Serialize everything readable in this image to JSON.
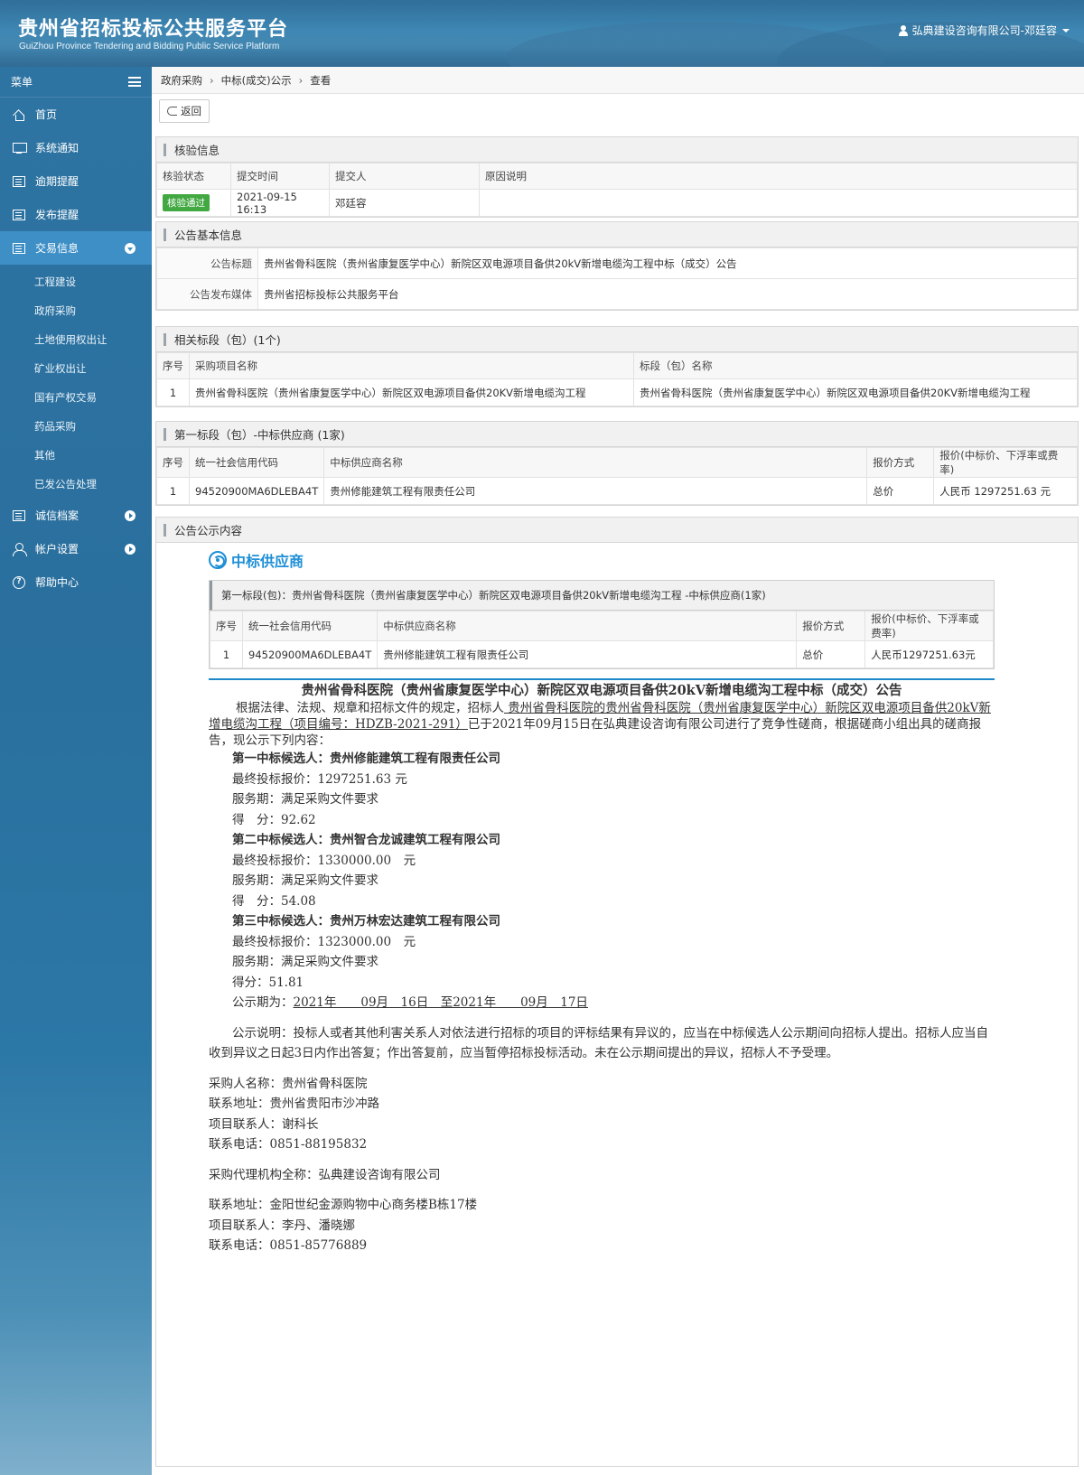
{
  "header": {
    "title": "贵州省招标投标公共服务平台",
    "subtitle": "GuiZhou Province Tendering and Bidding Public Service Platform",
    "user": "弘典建设咨询有限公司-邓廷容"
  },
  "sidebar": {
    "menu_label": "菜单",
    "items": [
      {
        "label": "首页",
        "icon": "home-icon"
      },
      {
        "label": "系统通知",
        "icon": "monitor-icon"
      },
      {
        "label": "逾期提醒",
        "icon": "list-icon"
      },
      {
        "label": "发布提醒",
        "icon": "list-icon"
      },
      {
        "label": "交易信息",
        "icon": "list-icon",
        "active": true
      }
    ],
    "sub_items": [
      "工程建设",
      "政府采购",
      "土地使用权出让",
      "矿业权出让",
      "国有产权交易",
      "药品采购",
      "其他",
      "已发公告处理"
    ],
    "bottom_items": [
      {
        "label": "诚信档案",
        "icon": "list-icon"
      },
      {
        "label": "帐户设置",
        "icon": "user-icon"
      },
      {
        "label": "帮助中心",
        "icon": "help-icon"
      }
    ],
    "colors": {
      "bg": "#2e74a3",
      "active": "#3d8fc6"
    }
  },
  "breadcrumb": [
    "政府采购",
    "中标(成交)公示",
    "查看"
  ],
  "toolbar": {
    "back_label": "返回"
  },
  "verify": {
    "title": "核验信息",
    "headers": [
      "核验状态",
      "提交时间",
      "提交人",
      "原因说明"
    ],
    "status": "核验通过",
    "time": "2021-09-15 16:13",
    "submitter": "邓廷容",
    "reason": ""
  },
  "basic": {
    "title": "公告基本信息",
    "notice_title_label": "公告标题",
    "notice_title": "贵州省骨科医院（贵州省康复医学中心）新院区双电源项目备供20kV新增电缆沟工程中标（成交）公告",
    "media_label": "公告发布媒体",
    "media": "贵州省招标投标公共服务平台"
  },
  "sections": {
    "title": "相关标段（包）(1个)",
    "headers": [
      "序号",
      "采购项目名称",
      "标段（包）名称"
    ],
    "rows": [
      [
        "1",
        "贵州省骨科医院（贵州省康复医学中心）新院区双电源项目备供20KV新增电缆沟工程",
        "贵州省骨科医院（贵州省康复医学中心）新院区双电源项目备供20KV新增电缆沟工程"
      ]
    ]
  },
  "winners": {
    "title": "第一标段（包）-中标供应商 (1家)",
    "headers": [
      "序号",
      "统一社会信用代码",
      "中标供应商名称",
      "报价方式",
      "报价(中标价、下浮率或费率)"
    ],
    "rows": [
      [
        "1",
        "94520900MA6DLEBA4T",
        "贵州修能建筑工程有限责任公司",
        "总价",
        "人民币 1297251.63 元"
      ]
    ]
  },
  "content": {
    "title": "公告公示内容",
    "win_title": "中标供应商",
    "inner_title": "第一标段(包)：贵州省骨科医院（贵州省康复医学中心）新院区双电源项目备供20kV新增电缆沟工程 -中标供应商(1家)",
    "inner_headers": [
      "序号",
      "统一社会信用代码",
      "中标供应商名称",
      "报价方式",
      "报价(中标价、下浮率或费率)"
    ],
    "inner_row": [
      "1",
      "94520900MA6DLEBA4T",
      "贵州修能建筑工程有限责任公司",
      "总价",
      "人民币1297251.63元"
    ],
    "doc_title": "贵州省骨科医院（贵州省康复医学中心）新院区双电源项目备供20kV新增电缆沟工程中标（成交）公告",
    "intro_a": "根据法律、法规、规章和招标文件的规定，招标人",
    "intro_b": " 贵州省骨科医院的贵州省骨科医院（贵州省康复医学中心）新院区双电源项目备供20kV新增电缆沟工程（项目编号：HDZB-2021-291）",
    "intro_c": "已于2021年09月15日在弘典建设咨询有限公司进行了竞争性磋商，根据磋商小组出具的磋商报告，现公示下列内容：",
    "c1_title": "第一中标候选人：贵州修能建筑工程有限责任公司",
    "c1_price": "最终投标报价：1297251.63 元",
    "c1_service": "服务期：满足采购文件要求",
    "c1_score": "得　分：92.62",
    "c2_title": "第二中标候选人：贵州智合龙诚建筑工程有限公司",
    "c2_price": "最终投标报价：1330000.00　元",
    "c2_service": "服务期：满足采购文件要求",
    "c2_score": "得　分：54.08",
    "c3_title": "第三中标候选人：贵州万林宏达建筑工程有限公司",
    "c3_price": "最终投标报价：1323000.00　元",
    "c3_service": "服务期：满足采购文件要求",
    "c3_score": "得分：51.81",
    "period_label": "公示期为：",
    "period_value": "2021年　　09月　16日　至2021年　　09月　17日",
    "remark": "公示说明：投标人或者其他利害关系人对依法进行招标的项目的评标结果有异议的，应当在中标候选人公示期间向招标人提出。招标人应当自收到异议之日起3日内作出答复；作出答复前，应当暂停招标投标活动。未在公示期间提出的异议，招标人不予受理。",
    "buyer_name": "采购人名称：贵州省骨科医院",
    "buyer_addr": "联系地址：贵州省贵阳市沙冲路",
    "buyer_contact": "项目联系人：谢科长",
    "buyer_phone": "联系电话：0851-88195832",
    "agency_name": "采购代理机构全称：弘典建设咨询有限公司",
    "agency_addr": "联系地址：金阳世纪金源购物中心商务楼B栋17楼",
    "agency_contact": "项目联系人：李丹、潘晓娜",
    "agency_phone": "联系电话：0851-85776889"
  }
}
